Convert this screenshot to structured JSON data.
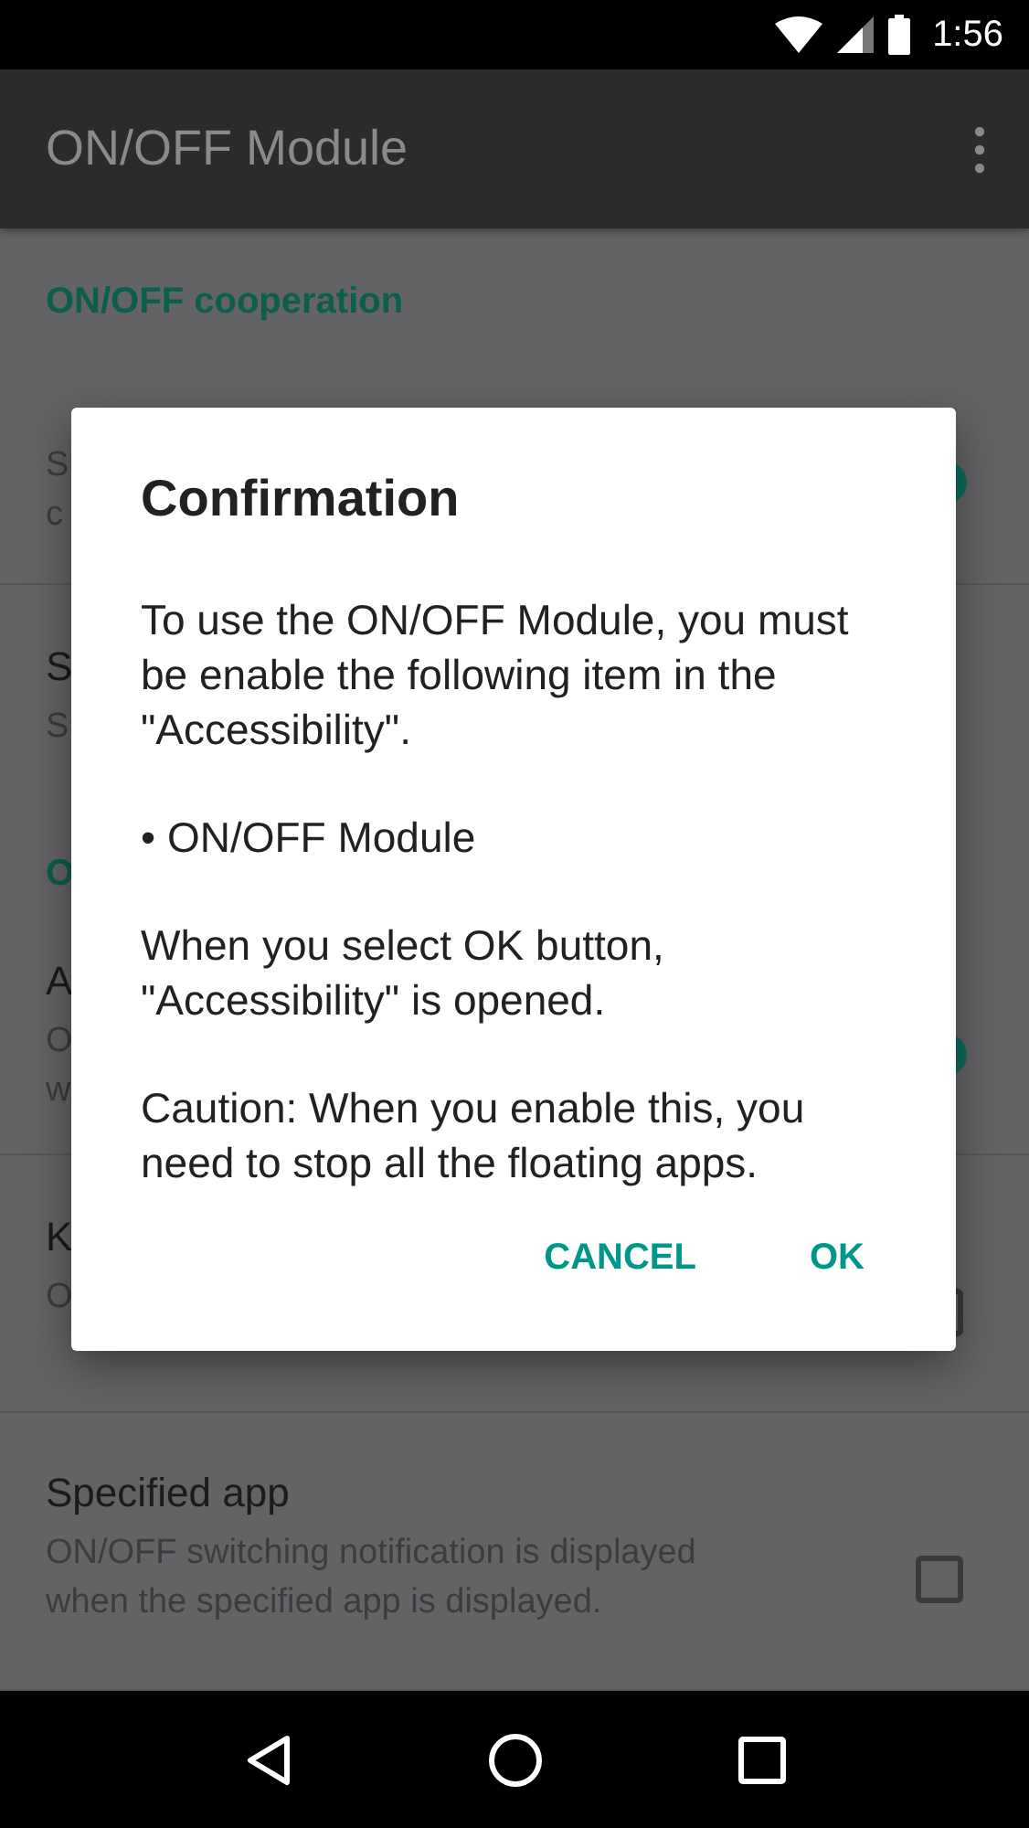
{
  "status_bar": {
    "time": "1:56"
  },
  "app_bar": {
    "title": "ON/OFF Module"
  },
  "sections": [
    {
      "header": "ON/OFF cooperation",
      "items": [
        {
          "summary": [
            "S",
            "c"
          ],
          "control": {
            "kind": "switch",
            "on": true
          }
        },
        {
          "title": "S",
          "summary": [
            "S"
          ]
        }
      ]
    },
    {
      "header": "O",
      "items": [
        {
          "title": "A",
          "summary": [
            "O",
            "w"
          ],
          "control": {
            "kind": "switch",
            "on": true
          }
        },
        {
          "title": "K",
          "summary": [
            "O"
          ],
          "control": {
            "kind": "checkbox",
            "checked": false
          }
        },
        {
          "title": "Specified app",
          "summary": [
            "ON/OFF switching notification is displayed",
            "when the specified app is displayed."
          ],
          "control": {
            "kind": "checkbox",
            "checked": false
          }
        }
      ]
    }
  ],
  "dialog": {
    "title": "Confirmation",
    "paragraphs": [
      "To use the ON/OFF Module, you must be enable the following item in the \"Accessibility\".",
      "• ON/OFF Module",
      "When you select OK button, \"Accessibility\" is opened.",
      "Caution: When you enable this, you need to stop all the floating apps."
    ],
    "buttons": [
      {
        "label": "CANCEL"
      },
      {
        "label": "OK"
      }
    ]
  }
}
